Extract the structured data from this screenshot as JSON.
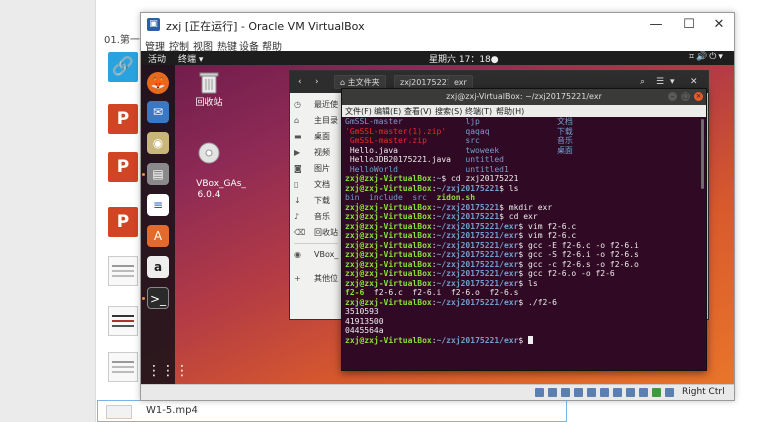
{
  "host": {
    "header": "01.第一周 (",
    "bottom_file": "W1-5.mp4"
  },
  "vbox": {
    "title": "zxj [正在运行] - Oracle VM VirtualBox",
    "menu": [
      "管理",
      "控制",
      "视图",
      "热键",
      "设备",
      "帮助"
    ],
    "status_right": "Right Ctrl"
  },
  "ubuntu": {
    "activities": "活动",
    "app_menu": "终端 ▾",
    "clock": "星期六 17：18●",
    "desktop": {
      "trash_label": "回收站",
      "disc_label": "VBox_GAs_\n6.0.4"
    }
  },
  "files": {
    "breadcrumbs": [
      "主文件夹",
      "zxj20175221",
      "exr"
    ],
    "sidebar": [
      "最近使",
      "主目录",
      "桌面",
      "视频",
      "图片",
      "文档",
      "下载",
      "音乐",
      "回收站",
      "VBox_",
      "其他位"
    ]
  },
  "terminal": {
    "title": "zxj@zxj-VirtualBox: ~/zxj20175221/exr",
    "menu": [
      "文件(F)",
      "编辑(E)",
      "查看(V)",
      "搜索(S)",
      "终端(T)",
      "帮助(H)"
    ],
    "prompt_user": "zxj@zxj-VirtualBox",
    "lines": [
      [
        {
          "t": "GmSSL-master             ",
          "c": "c-blue"
        },
        {
          "t": "ljp                ",
          "c": "c-blue"
        },
        {
          "t": "文档",
          "c": "c-blue"
        }
      ],
      [
        {
          "t": "'GmSSL-master(1).zip'    ",
          "c": "c-red"
        },
        {
          "t": "qaqaq              ",
          "c": "c-blue"
        },
        {
          "t": "下载",
          "c": "c-blue"
        }
      ],
      [
        {
          "t": " GmSSL-master.zip        ",
          "c": "c-red"
        },
        {
          "t": "src                ",
          "c": "c-blue"
        },
        {
          "t": "音乐",
          "c": "c-blue"
        }
      ],
      [
        {
          "t": " Hello.java              ",
          "c": "c-white"
        },
        {
          "t": "twoweek            ",
          "c": "c-blue"
        },
        {
          "t": "桌面",
          "c": "c-blue"
        }
      ],
      [
        {
          "t": " HelloJDB20175221.java   ",
          "c": "c-white"
        },
        {
          "t": "untitled",
          "c": "c-blue"
        }
      ],
      [
        {
          "t": " HelloWorld              ",
          "c": "c-blue"
        },
        {
          "t": "untitled1",
          "c": "c-blue"
        }
      ],
      [
        {
          "t": "zxj@zxj-VirtualBox",
          "c": "c-user"
        },
        {
          "t": ":",
          "c": "c-white"
        },
        {
          "t": "~",
          "c": "c-path"
        },
        {
          "t": "$ cd zxj20175221",
          "c": "c-white"
        }
      ],
      [
        {
          "t": "zxj@zxj-VirtualBox",
          "c": "c-user"
        },
        {
          "t": ":",
          "c": "c-white"
        },
        {
          "t": "~/zxj20175221",
          "c": "c-path"
        },
        {
          "t": "$ ls",
          "c": "c-white"
        }
      ],
      [
        {
          "t": "bin  include  src  ",
          "c": "c-blue"
        },
        {
          "t": "zidon.sh",
          "c": "c-green"
        }
      ],
      [
        {
          "t": "zxj@zxj-VirtualBox",
          "c": "c-user"
        },
        {
          "t": ":",
          "c": "c-white"
        },
        {
          "t": "~/zxj20175221",
          "c": "c-path"
        },
        {
          "t": "$ mkdir exr",
          "c": "c-white"
        }
      ],
      [
        {
          "t": "zxj@zxj-VirtualBox",
          "c": "c-user"
        },
        {
          "t": ":",
          "c": "c-white"
        },
        {
          "t": "~/zxj20175221",
          "c": "c-path"
        },
        {
          "t": "$ cd exr",
          "c": "c-white"
        }
      ],
      [
        {
          "t": "zxj@zxj-VirtualBox",
          "c": "c-user"
        },
        {
          "t": ":",
          "c": "c-white"
        },
        {
          "t": "~/zxj20175221/exr",
          "c": "c-path"
        },
        {
          "t": "$ vim f2-6.c",
          "c": "c-white"
        }
      ],
      [
        {
          "t": "zxj@zxj-VirtualBox",
          "c": "c-user"
        },
        {
          "t": ":",
          "c": "c-white"
        },
        {
          "t": "~/zxj20175221/exr",
          "c": "c-path"
        },
        {
          "t": "$ vim f2-6.c",
          "c": "c-white"
        }
      ],
      [
        {
          "t": "zxj@zxj-VirtualBox",
          "c": "c-user"
        },
        {
          "t": ":",
          "c": "c-white"
        },
        {
          "t": "~/zxj20175221/exr",
          "c": "c-path"
        },
        {
          "t": "$ gcc -E f2-6.c -o f2-6.i",
          "c": "c-white"
        }
      ],
      [
        {
          "t": "zxj@zxj-VirtualBox",
          "c": "c-user"
        },
        {
          "t": ":",
          "c": "c-white"
        },
        {
          "t": "~/zxj20175221/exr",
          "c": "c-path"
        },
        {
          "t": "$ gcc -S f2-6.i -o f2-6.s",
          "c": "c-white"
        }
      ],
      [
        {
          "t": "zxj@zxj-VirtualBox",
          "c": "c-user"
        },
        {
          "t": ":",
          "c": "c-white"
        },
        {
          "t": "~/zxj20175221/exr",
          "c": "c-path"
        },
        {
          "t": "$ gcc -c f2-6.s -o f2-6.o",
          "c": "c-white"
        }
      ],
      [
        {
          "t": "zxj@zxj-VirtualBox",
          "c": "c-user"
        },
        {
          "t": ":",
          "c": "c-white"
        },
        {
          "t": "~/zxj20175221/exr",
          "c": "c-path"
        },
        {
          "t": "$ gcc f2-6.o -o f2-6",
          "c": "c-white"
        }
      ],
      [
        {
          "t": "zxj@zxj-VirtualBox",
          "c": "c-user"
        },
        {
          "t": ":",
          "c": "c-white"
        },
        {
          "t": "~/zxj20175221/exr",
          "c": "c-path"
        },
        {
          "t": "$ ls",
          "c": "c-white"
        }
      ],
      [
        {
          "t": "f2-6",
          "c": "c-green"
        },
        {
          "t": "  f2-6.c  f2-6.i  f2-6.o  f2-6.s",
          "c": "c-white"
        }
      ],
      [
        {
          "t": "zxj@zxj-VirtualBox",
          "c": "c-user"
        },
        {
          "t": ":",
          "c": "c-white"
        },
        {
          "t": "~/zxj20175221/exr",
          "c": "c-path"
        },
        {
          "t": "$ ./f2-6",
          "c": "c-white"
        }
      ],
      [
        {
          "t": "3510593",
          "c": "c-white"
        }
      ],
      [
        {
          "t": "41913500",
          "c": "c-white"
        }
      ],
      [
        {
          "t": "0445564a",
          "c": "c-white"
        }
      ],
      [
        {
          "t": "zxj@zxj-VirtualBox",
          "c": "c-user"
        },
        {
          "t": ":",
          "c": "c-white"
        },
        {
          "t": "~/zxj20175221/exr",
          "c": "c-path"
        },
        {
          "t": "$ ",
          "c": "c-white"
        }
      ]
    ]
  },
  "colors": {
    "terminal_bg": "#300a24",
    "ubuntu_orange": "#e9752a",
    "prompt_green": "#8ae234",
    "path_blue": "#729fcf"
  }
}
